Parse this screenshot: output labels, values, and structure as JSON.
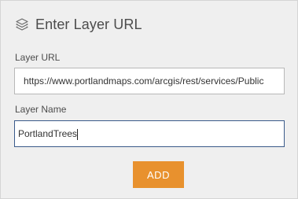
{
  "panel": {
    "title": "Enter Layer URL",
    "icon": "layers-icon"
  },
  "layer_url": {
    "label": "Layer URL",
    "value": "https://www.portlandmaps.com/arcgis/rest/services/Public"
  },
  "layer_name": {
    "label": "Layer Name",
    "value": "PortlandTrees"
  },
  "add_button": {
    "label": "ADD",
    "color": "#e8912e"
  }
}
